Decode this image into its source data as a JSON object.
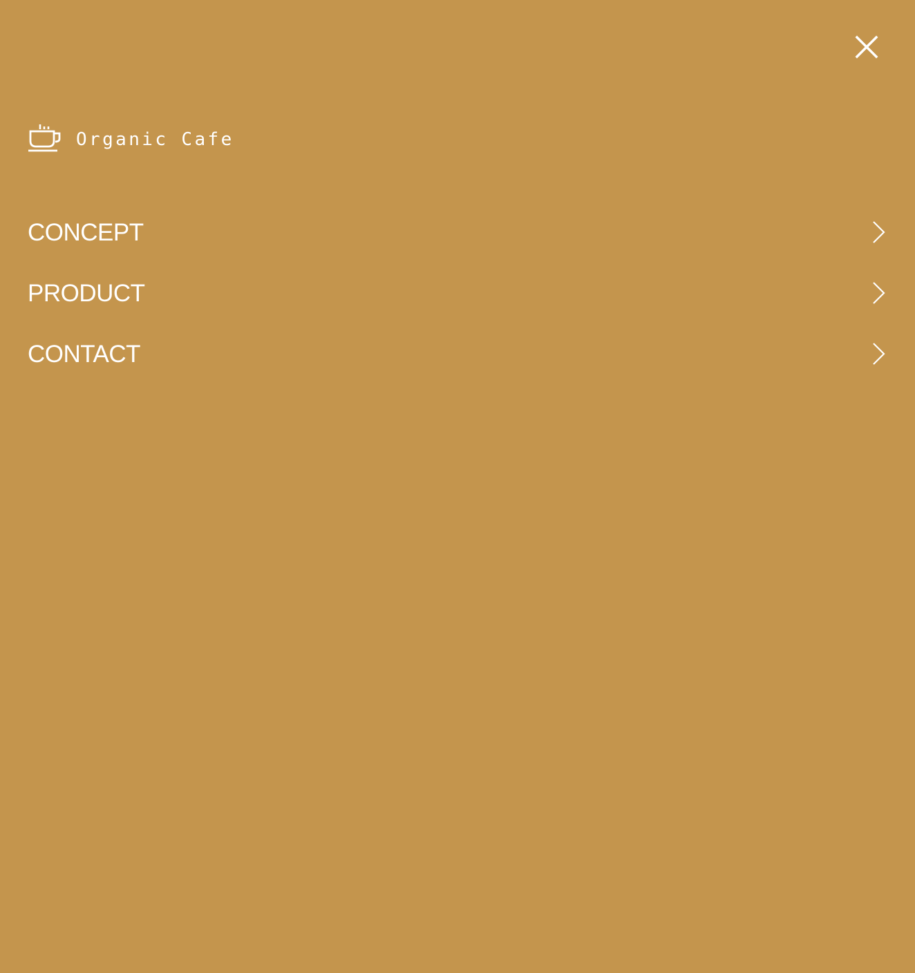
{
  "nav_drawer": {
    "close_icon": "close-icon",
    "brand": {
      "name": "Organic Cafe",
      "icon": "coffee-cup-icon"
    },
    "menu": {
      "items": [
        {
          "label": "CONCEPT",
          "icon": "chevron-right-icon"
        },
        {
          "label": "PRODUCT",
          "icon": "chevron-right-icon"
        },
        {
          "label": "CONTACT",
          "icon": "chevron-right-icon"
        }
      ]
    },
    "colors": {
      "background": "#c4954d",
      "foreground": "#ffffff"
    }
  }
}
